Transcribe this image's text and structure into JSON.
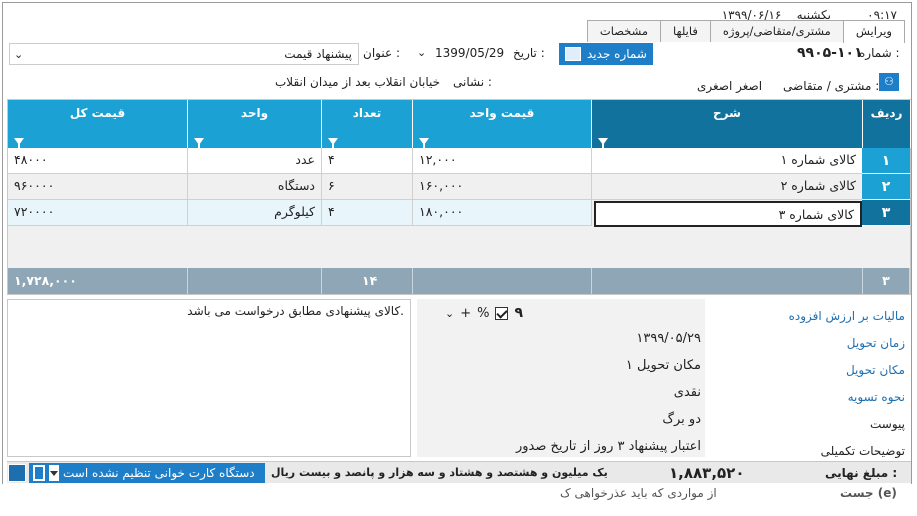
{
  "header": {
    "time": "۰۹:۱۷",
    "weekday": "یکشنبه",
    "date": "۱۳۹۹/۰۶/۱۶",
    "tabs": [
      "ویرایش",
      "مشتری/متقاضی/پروژه",
      "فایلها",
      "مشخصات"
    ],
    "active_tab": "ویرایش"
  },
  "form": {
    "number_label": "شماره :",
    "number_value": "۹۹۰۵-۱۰۱",
    "new_number_btn": "شماره جدید",
    "date_label": "تاریخ :",
    "date_value": "1399/05/29",
    "title_label": "عنوان :",
    "title_value": "پیشنهاد قیمت",
    "customer_label": "مشتری / متقاضی :",
    "customer_value": "اصغر اصغری",
    "address_label": "نشانی :",
    "address_value": "خیابان انقلاب بعد از میدان انقلاب"
  },
  "grid": {
    "columns": {
      "row": "ردیف",
      "desc": "شرح",
      "unit_price": "قیمت واحد",
      "qty": "تعداد",
      "unit": "واحد",
      "total": "قیمت کل"
    },
    "rows": [
      {
        "no": "۱",
        "desc": "کالای شماره ۱",
        "unit_price": "۱۲,۰۰۰",
        "qty": "۴",
        "unit": "عدد",
        "total": "۴۸۰۰۰"
      },
      {
        "no": "۲",
        "desc": "کالای شماره ۲",
        "unit_price": "۱۶۰,۰۰۰",
        "qty": "۶",
        "unit": "دستگاه",
        "total": "۹۶۰۰۰۰"
      },
      {
        "no": "۳",
        "desc": "کالای شماره ۳",
        "unit_price": "۱۸۰,۰۰۰",
        "qty": "۴",
        "unit": "کیلوگرم",
        "total": "۷۲۰۰۰۰"
      }
    ],
    "footer": {
      "count": "۳",
      "qty_sum": "۱۴",
      "total_sum": "۱,۷۲۸,۰۰۰"
    }
  },
  "notes": "کالای پیشنهادی مطابق درخواست می باشد.",
  "details": {
    "vat_label": "مالیات بر ارزش افزوده",
    "vat_value": "۹",
    "vat_percent": "%",
    "delivery_time_label": "زمان تحویل",
    "delivery_time_value": "۱۳۹۹/۰۵/۲۹",
    "delivery_place_label": "مکان تحویل",
    "delivery_place_value": "مکان تحویل ۱",
    "payment_label": "نحوه تسویه",
    "payment_value": "نقدی",
    "attachment_label": "پیوست",
    "attachment_value": "دو برگ",
    "extra_label": "توضیحات تکمیلی",
    "extra_value": "اعتبار پیشنهاد ۳ روز از تاریخ صدور"
  },
  "status": {
    "final_label": "مبلغ نهایی :",
    "final_value": "۱,۸۸۳,۵۲۰",
    "final_words": "یک میلیون و هشتصد و هشتاد و سه هزار و پانصد و بیست ریال",
    "device_text": "دستگاه کارت خوانی تنظیم نشده است"
  },
  "ghost": {
    "left": "از مواردی که باید عذرخواهی ک",
    "right": "جست (e)"
  },
  "colors": {
    "accent": "#1ba1d4",
    "accent_dark": "#11729d",
    "button": "#1e7ec8",
    "footer": "#8ea6b5"
  }
}
